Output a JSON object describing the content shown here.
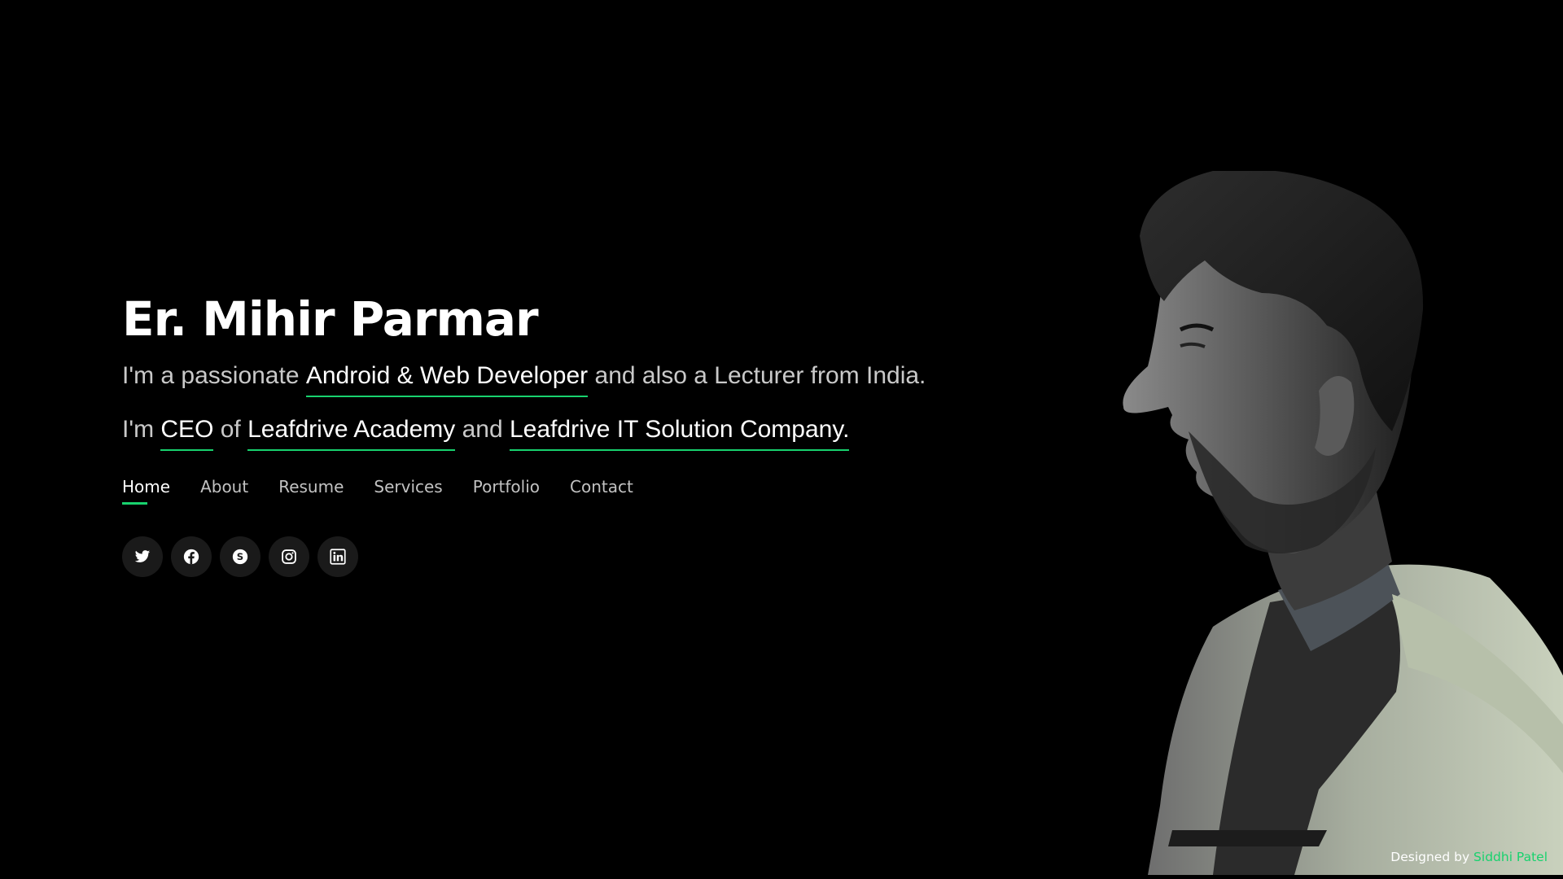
{
  "hero": {
    "name": "Er. Mihir Parmar",
    "line1": {
      "prefix": "I'm a passionate ",
      "highlight": "Android & Web Developer",
      "suffix": " and also a Lecturer from India."
    },
    "line2": {
      "prefix": "I'm ",
      "highlight1": "CEO",
      "mid1": " of ",
      "highlight2": "Leafdrive Academy",
      "mid2": " and ",
      "highlight3": "Leafdrive IT Solution Company",
      "suffix": "."
    }
  },
  "nav": {
    "items": [
      "Home",
      "About",
      "Resume",
      "Services",
      "Portfolio",
      "Contact"
    ],
    "active": "Home"
  },
  "social": {
    "icons": [
      "twitter-icon",
      "facebook-icon",
      "skype-icon",
      "instagram-icon",
      "linkedin-icon"
    ]
  },
  "footer": {
    "prefix": "Designed by ",
    "credit": "Siddhi Patel"
  },
  "colors": {
    "background": "#000000",
    "accent": "#18d26e",
    "text": "#ffffff",
    "muted_text": "#c9c9c9",
    "social_button_bg": "#1a1a1a"
  }
}
